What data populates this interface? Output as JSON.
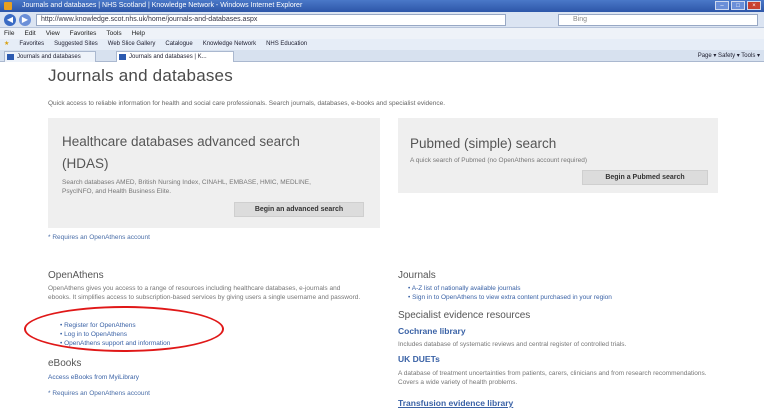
{
  "browser": {
    "window_title": "Journals and databases | NHS Scotland | Knowledge Network - Windows Internet Explorer",
    "url": "http://www.knowledge.scot.nhs.uk/home/journals-and-databases.aspx",
    "search_placeholder": "Bing",
    "menu": [
      "File",
      "Edit",
      "View",
      "Favorites",
      "Tools",
      "Help"
    ],
    "favorites": [
      "Favorites",
      "Suggested Sites",
      "Web Slice Gallery",
      "Catalogue",
      "Knowledge Network",
      "NHS Education"
    ],
    "tabs": [
      "Journals and databases",
      "Journals and databases | K..."
    ],
    "command_bar": "Page ▾  Safety ▾  Tools ▾"
  },
  "page": {
    "title": "Journals and databases",
    "intro": "Quick access to reliable information for health and social care professionals. Search journals, databases, e-books and specialist evidence."
  },
  "hdas": {
    "title_line1": "Healthcare databases advanced search",
    "title_line2": "(HDAS)",
    "description": "Search databases AMED, British Nursing Index, CINAHL, EMBASE, HMIC, MEDLINE, PsycINFO, and Health Business Elite.",
    "button": "Begin an advanced search",
    "note": "* Requires an OpenAthens account"
  },
  "pubmed": {
    "title": "Pubmed (simple) search",
    "description": "A quick search of Pubmed (no OpenAthens account required)",
    "button": "Begin a Pubmed search"
  },
  "openathens": {
    "heading": "OpenAthens",
    "description": "OpenAthens gives you access to a range of resources including healthcare databases, e-journals and ebooks. It simplifies access to subscription-based services by giving users a single username and password.",
    "links": [
      "Register for OpenAthens",
      "Log in to OpenAthens",
      "OpenAthens support and information"
    ]
  },
  "ebooks": {
    "heading": "eBooks",
    "link": "Access eBooks from MyiLibrary",
    "note": "* Requires an OpenAthens account"
  },
  "journals": {
    "heading": "Journals",
    "links": [
      "A-Z list of nationally available journals",
      "Sign in to OpenAthens to view extra content purchased in your region"
    ]
  },
  "specialist": {
    "heading": "Specialist evidence resources",
    "items": [
      {
        "name": "Cochrane library",
        "description": "Includes database of systematic reviews and central register of controlled trials."
      },
      {
        "name": "UK DUETs",
        "description": "A database of treatment uncertainties from patients, carers, clinicians and from research recommendations. Covers a wide variety of health problems."
      },
      {
        "name": "Transfusion evidence library",
        "description": ""
      }
    ]
  }
}
